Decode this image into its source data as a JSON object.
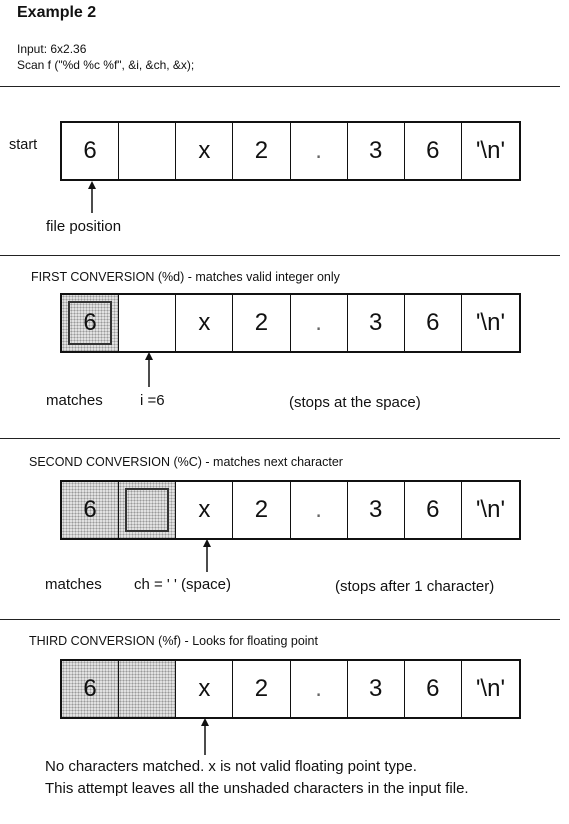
{
  "title": "Example 2",
  "input_line": "Input: 6x2.36",
  "scan_line": "Scan f (\"%d %c %f\", &i, &ch, &x);",
  "sections": [
    {
      "id": "start",
      "side_label": "start",
      "cells": [
        "6",
        "",
        "x",
        "2",
        ".",
        "3",
        "6",
        "'\\n'"
      ],
      "shaded": [],
      "boxed": [],
      "pointer_label": "file position"
    },
    {
      "id": "first",
      "heading": "FIRST CONVERSION (%d) - matches valid integer only",
      "cells": [
        "6",
        "",
        "x",
        "2",
        ".",
        "3",
        "6",
        "'\\n'"
      ],
      "shaded": [
        0
      ],
      "boxed": [
        0
      ],
      "matches_label": "matches",
      "result": "i =6",
      "note": "(stops at the space)"
    },
    {
      "id": "second",
      "heading": "SECOND CONVERSION (%C) - matches next character",
      "cells": [
        "6",
        "",
        "x",
        "2",
        ".",
        "3",
        "6",
        "'\\n'"
      ],
      "shaded": [
        0,
        1
      ],
      "boxed": [
        1
      ],
      "matches_label": "matches",
      "result": "ch = ' ' (space)",
      "note": "(stops after 1 character)"
    },
    {
      "id": "third",
      "heading": "THIRD CONVERSION (%f) - Looks for floating point",
      "cells": [
        "6",
        "",
        "x",
        "2",
        ".",
        "3",
        "6",
        "'\\n'"
      ],
      "shaded": [
        0,
        1
      ],
      "boxed": [],
      "message_line1": "No characters matched. x is not valid floating point type.",
      "message_line2": "This attempt leaves all the unshaded characters in the input file."
    }
  ]
}
